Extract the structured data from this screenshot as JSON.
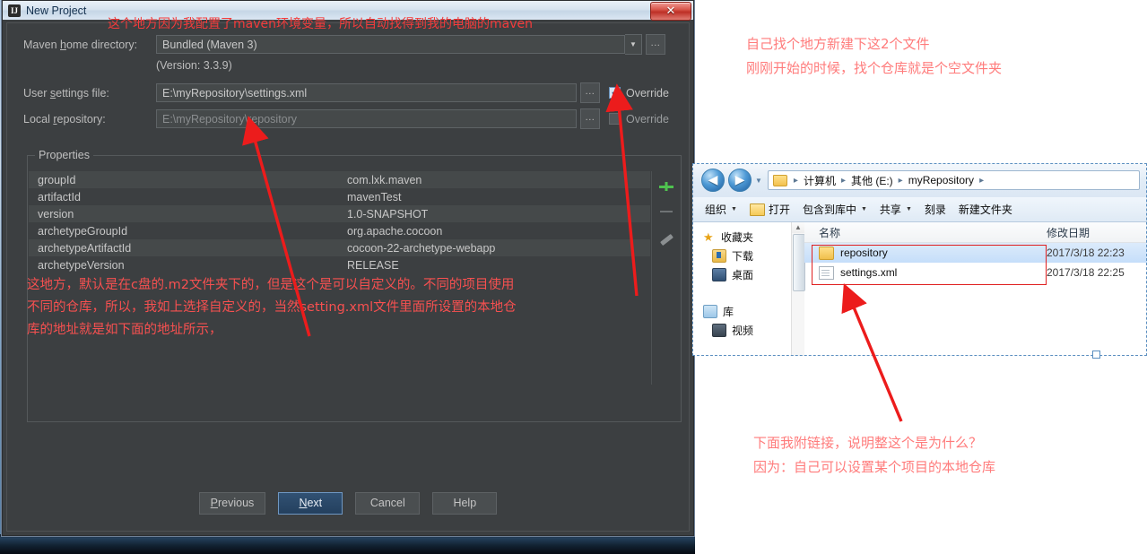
{
  "dialog": {
    "title": "New Project",
    "close_label": "✕",
    "fields": [
      {
        "label_pre": "Maven ",
        "label_mn": "h",
        "label_post": "ome directory:",
        "value": "Bundled (Maven 3)",
        "ellipsis": "..."
      },
      {
        "label_pre": "User ",
        "label_mn": "s",
        "label_post": "ettings file:",
        "value": "E:\\myRepository\\settings.xml",
        "ellipsis": "...",
        "override": "Override"
      },
      {
        "label_pre": "Local ",
        "label_mn": "r",
        "label_post": "epository:",
        "value": "E:\\myRepository\\repository",
        "ellipsis": "...",
        "override": "Override"
      }
    ],
    "version_note": "(Version: 3.3.9)",
    "properties": {
      "legend": "Properties",
      "rows": [
        {
          "key": "groupId",
          "value": "com.lxk.maven"
        },
        {
          "key": "artifactId",
          "value": "mavenTest"
        },
        {
          "key": "version",
          "value": "1.0-SNAPSHOT"
        },
        {
          "key": "archetypeGroupId",
          "value": "org.apache.cocoon"
        },
        {
          "key": "archetypeArtifactId",
          "value": "cocoon-22-archetype-webapp"
        },
        {
          "key": "archetypeVersion",
          "value": "RELEASE"
        }
      ],
      "toolbar": {
        "add": "add-icon",
        "remove": "remove-icon",
        "edit": "edit-icon"
      }
    },
    "buttons": {
      "previous_pre": "",
      "previous_mn": "P",
      "previous_post": "revious",
      "next_pre": "",
      "next_mn": "N",
      "next_post": "ext",
      "cancel": "Cancel",
      "help": "Help"
    }
  },
  "annotations": {
    "top": "这个地方因为我配置了maven环境变量，所以自动找得到我的电脑的maven",
    "middle_line1": "这地方，默认是在c盘的.m2文件夹下的，但是这个是可以自定义的。不同的项目使用",
    "middle_line2": "不同的仓库，所以，我如上选择自定义的，当然setting.xml文件里面所设置的本地仓",
    "middle_line3": "库的地址就是如下面的地址所示，",
    "right_top_line1": "自己找个地方新建下这2个文件",
    "right_top_line2": "刚刚开始的时候，找个仓库就是个空文件夹",
    "right_bottom_line1": "下面我附链接，说明整这个是为什么？",
    "right_bottom_line2": "因为：自己可以设置某个项目的本地仓库"
  },
  "explorer": {
    "nav": {
      "back": "◀",
      "forward": "▶",
      "history": "▼"
    },
    "breadcrumbs": [
      "计算机",
      "其他 (E:)",
      "myRepository"
    ],
    "breadcrumb_sep": "▸",
    "toolbar": [
      {
        "label": "组织",
        "caret": "▼"
      },
      {
        "label": "打开",
        "caret": ""
      },
      {
        "label": "包含到库中",
        "caret": "▼"
      },
      {
        "label": "共享",
        "caret": "▼"
      },
      {
        "label": "刻录",
        "caret": ""
      },
      {
        "label": "新建文件夹",
        "caret": ""
      }
    ],
    "sidebar": [
      {
        "label": "收藏夹",
        "icon": "star-icon",
        "indent": false
      },
      {
        "label": "下载",
        "icon": "download-icon",
        "indent": true
      },
      {
        "label": "桌面",
        "icon": "desktop-icon",
        "indent": true
      },
      {
        "label": "库",
        "icon": "library-icon",
        "indent": false
      },
      {
        "label": "视频",
        "icon": "video-icon",
        "indent": true
      }
    ],
    "columns": {
      "name": "名称",
      "date": "修改日期"
    },
    "files": [
      {
        "name": "repository",
        "date": "2017/3/18 22:23",
        "icon": "folder-icon",
        "selected": true
      },
      {
        "name": "settings.xml",
        "date": "2017/3/18 22:25",
        "icon": "xml-file-icon",
        "selected": false
      }
    ]
  },
  "colors": {
    "annotation_red": "#ff2d2d",
    "dialog_bg": "#3c3f41",
    "accent_blue": "#2f5b8a"
  }
}
